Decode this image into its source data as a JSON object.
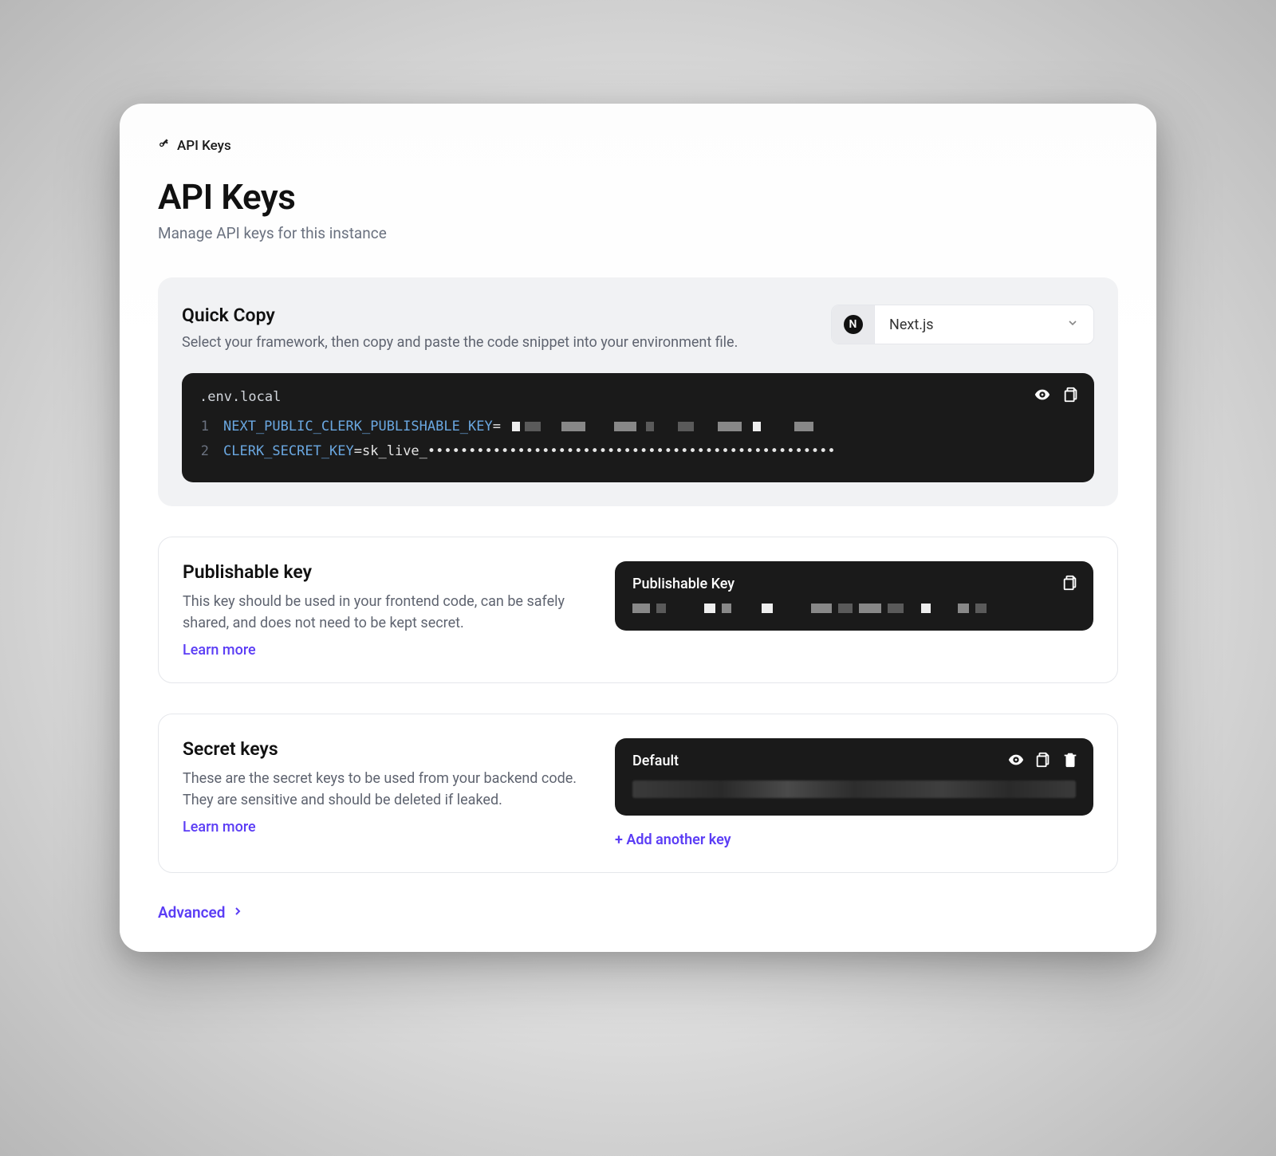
{
  "breadcrumb": {
    "label": "API Keys"
  },
  "header": {
    "title": "API Keys",
    "subtitle": "Manage API keys for this instance"
  },
  "quick_copy": {
    "title": "Quick Copy",
    "subtitle": "Select your framework, then copy and paste the code snippet into your environment file.",
    "framework_label": "Next.js",
    "filename": ".env.local",
    "lines": [
      {
        "no": "1",
        "var": "NEXT_PUBLIC_CLERK_PUBLISHABLE_KEY",
        "eq": "="
      },
      {
        "no": "2",
        "var": "CLERK_SECRET_KEY",
        "eq": "=",
        "value": "sk_live_••••••••••••••••••••••••••••••••••••••••••••••••••"
      }
    ]
  },
  "publishable": {
    "title": "Publishable key",
    "desc": "This key should be used in your frontend code, can be safely shared, and does not need to be kept secret.",
    "learn_more": "Learn more",
    "box_title": "Publishable Key"
  },
  "secret": {
    "title": "Secret keys",
    "desc": "These are the secret keys to be used from your backend code. They are sensitive and should be deleted if leaked.",
    "learn_more": "Learn more",
    "box_title": "Default",
    "add_another": "+ Add another key"
  },
  "advanced_label": "Advanced"
}
